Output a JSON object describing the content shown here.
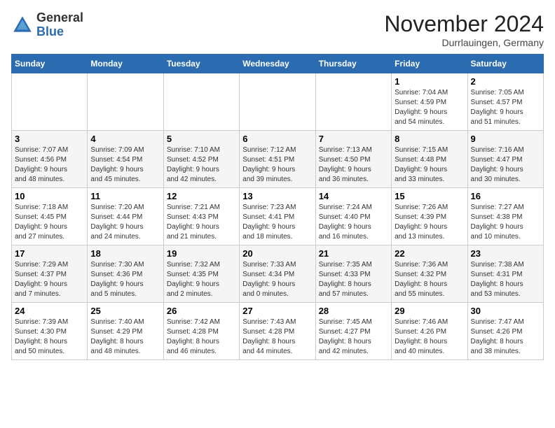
{
  "header": {
    "logo_general": "General",
    "logo_blue": "Blue",
    "month_title": "November 2024",
    "location": "Durrlauingen, Germany"
  },
  "weekdays": [
    "Sunday",
    "Monday",
    "Tuesday",
    "Wednesday",
    "Thursday",
    "Friday",
    "Saturday"
  ],
  "weeks": [
    [
      {
        "day": "",
        "info": ""
      },
      {
        "day": "",
        "info": ""
      },
      {
        "day": "",
        "info": ""
      },
      {
        "day": "",
        "info": ""
      },
      {
        "day": "",
        "info": ""
      },
      {
        "day": "1",
        "info": "Sunrise: 7:04 AM\nSunset: 4:59 PM\nDaylight: 9 hours\nand 54 minutes."
      },
      {
        "day": "2",
        "info": "Sunrise: 7:05 AM\nSunset: 4:57 PM\nDaylight: 9 hours\nand 51 minutes."
      }
    ],
    [
      {
        "day": "3",
        "info": "Sunrise: 7:07 AM\nSunset: 4:56 PM\nDaylight: 9 hours\nand 48 minutes."
      },
      {
        "day": "4",
        "info": "Sunrise: 7:09 AM\nSunset: 4:54 PM\nDaylight: 9 hours\nand 45 minutes."
      },
      {
        "day": "5",
        "info": "Sunrise: 7:10 AM\nSunset: 4:52 PM\nDaylight: 9 hours\nand 42 minutes."
      },
      {
        "day": "6",
        "info": "Sunrise: 7:12 AM\nSunset: 4:51 PM\nDaylight: 9 hours\nand 39 minutes."
      },
      {
        "day": "7",
        "info": "Sunrise: 7:13 AM\nSunset: 4:50 PM\nDaylight: 9 hours\nand 36 minutes."
      },
      {
        "day": "8",
        "info": "Sunrise: 7:15 AM\nSunset: 4:48 PM\nDaylight: 9 hours\nand 33 minutes."
      },
      {
        "day": "9",
        "info": "Sunrise: 7:16 AM\nSunset: 4:47 PM\nDaylight: 9 hours\nand 30 minutes."
      }
    ],
    [
      {
        "day": "10",
        "info": "Sunrise: 7:18 AM\nSunset: 4:45 PM\nDaylight: 9 hours\nand 27 minutes."
      },
      {
        "day": "11",
        "info": "Sunrise: 7:20 AM\nSunset: 4:44 PM\nDaylight: 9 hours\nand 24 minutes."
      },
      {
        "day": "12",
        "info": "Sunrise: 7:21 AM\nSunset: 4:43 PM\nDaylight: 9 hours\nand 21 minutes."
      },
      {
        "day": "13",
        "info": "Sunrise: 7:23 AM\nSunset: 4:41 PM\nDaylight: 9 hours\nand 18 minutes."
      },
      {
        "day": "14",
        "info": "Sunrise: 7:24 AM\nSunset: 4:40 PM\nDaylight: 9 hours\nand 16 minutes."
      },
      {
        "day": "15",
        "info": "Sunrise: 7:26 AM\nSunset: 4:39 PM\nDaylight: 9 hours\nand 13 minutes."
      },
      {
        "day": "16",
        "info": "Sunrise: 7:27 AM\nSunset: 4:38 PM\nDaylight: 9 hours\nand 10 minutes."
      }
    ],
    [
      {
        "day": "17",
        "info": "Sunrise: 7:29 AM\nSunset: 4:37 PM\nDaylight: 9 hours\nand 7 minutes."
      },
      {
        "day": "18",
        "info": "Sunrise: 7:30 AM\nSunset: 4:36 PM\nDaylight: 9 hours\nand 5 minutes."
      },
      {
        "day": "19",
        "info": "Sunrise: 7:32 AM\nSunset: 4:35 PM\nDaylight: 9 hours\nand 2 minutes."
      },
      {
        "day": "20",
        "info": "Sunrise: 7:33 AM\nSunset: 4:34 PM\nDaylight: 9 hours\nand 0 minutes."
      },
      {
        "day": "21",
        "info": "Sunrise: 7:35 AM\nSunset: 4:33 PM\nDaylight: 8 hours\nand 57 minutes."
      },
      {
        "day": "22",
        "info": "Sunrise: 7:36 AM\nSunset: 4:32 PM\nDaylight: 8 hours\nand 55 minutes."
      },
      {
        "day": "23",
        "info": "Sunrise: 7:38 AM\nSunset: 4:31 PM\nDaylight: 8 hours\nand 53 minutes."
      }
    ],
    [
      {
        "day": "24",
        "info": "Sunrise: 7:39 AM\nSunset: 4:30 PM\nDaylight: 8 hours\nand 50 minutes."
      },
      {
        "day": "25",
        "info": "Sunrise: 7:40 AM\nSunset: 4:29 PM\nDaylight: 8 hours\nand 48 minutes."
      },
      {
        "day": "26",
        "info": "Sunrise: 7:42 AM\nSunset: 4:28 PM\nDaylight: 8 hours\nand 46 minutes."
      },
      {
        "day": "27",
        "info": "Sunrise: 7:43 AM\nSunset: 4:28 PM\nDaylight: 8 hours\nand 44 minutes."
      },
      {
        "day": "28",
        "info": "Sunrise: 7:45 AM\nSunset: 4:27 PM\nDaylight: 8 hours\nand 42 minutes."
      },
      {
        "day": "29",
        "info": "Sunrise: 7:46 AM\nSunset: 4:26 PM\nDaylight: 8 hours\nand 40 minutes."
      },
      {
        "day": "30",
        "info": "Sunrise: 7:47 AM\nSunset: 4:26 PM\nDaylight: 8 hours\nand 38 minutes."
      }
    ]
  ]
}
